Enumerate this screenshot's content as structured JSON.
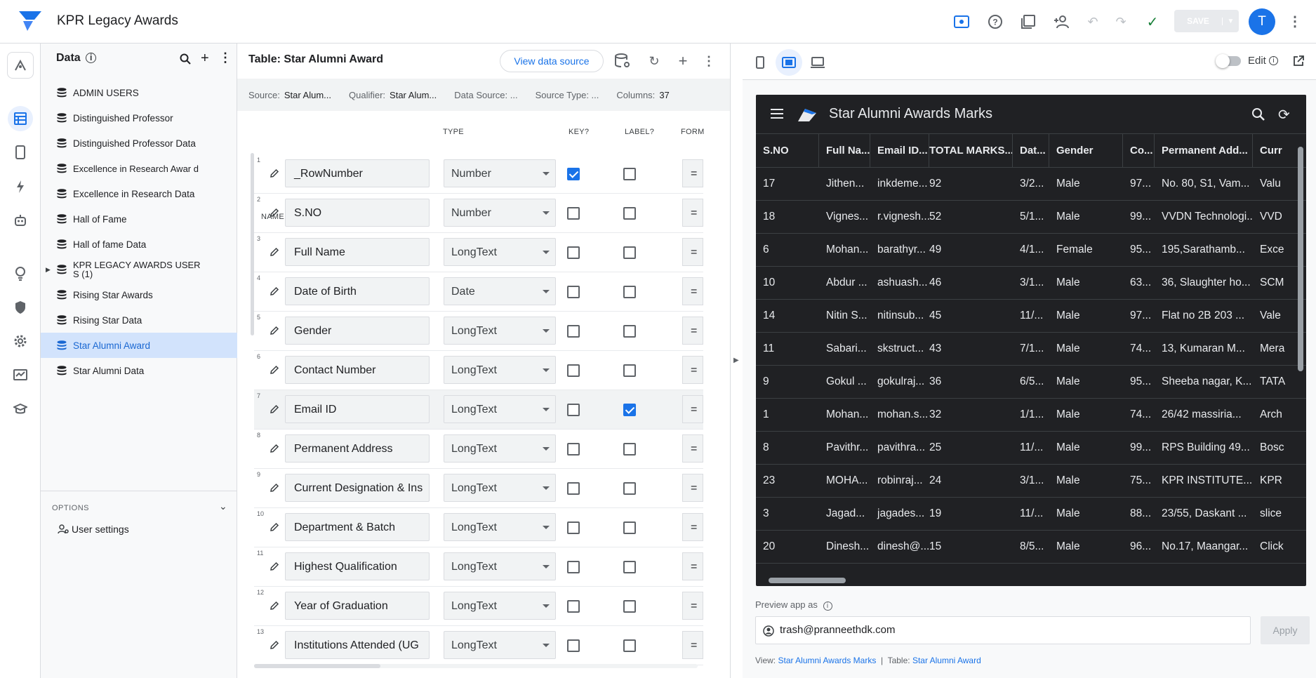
{
  "app": {
    "title": "KPR Legacy Awards",
    "accent": "#1a73e8"
  },
  "toolbar": {
    "save_label": "SAVE",
    "avatar_letter": "T"
  },
  "data_panel": {
    "title": "Data",
    "items": [
      {
        "label": "ADMIN USERS"
      },
      {
        "label": "Distinguished Professor"
      },
      {
        "label": "Distinguished Professor Data"
      },
      {
        "label": "Excellence in Research Awar d"
      },
      {
        "label": "Excellence in Research Data"
      },
      {
        "label": "Hall of Fame"
      },
      {
        "label": "Hall of fame Data"
      },
      {
        "label": "KPR LEGACY AWARDS USER S (1)"
      },
      {
        "label": "Rising Star Awards"
      },
      {
        "label": "Rising Star Data"
      },
      {
        "label": "Star Alumni Award"
      },
      {
        "label": "Star Alumni Data"
      }
    ],
    "options_label": "OPTIONS",
    "user_settings": "User settings"
  },
  "table_panel": {
    "title": "Table: Star Alumni Award",
    "view_source_btn": "View data source",
    "meta": {
      "source_label": "Source:",
      "source_value": "Star Alum...",
      "qualifier_label": "Qualifier:",
      "qualifier_value": "Star Alum...",
      "datasource_label": "Data Source: ...",
      "sourcetype_label": "Source Type: ...",
      "columns_label": "Columns:",
      "columns_value": "37"
    },
    "headers": {
      "name": "NAME",
      "type": "TYPE",
      "key": "KEY?",
      "label": "LABEL?",
      "formula": "FORM"
    },
    "columns": [
      {
        "num": "1",
        "name": "_RowNumber",
        "type": "Number",
        "key": true,
        "label": false,
        "eq": "="
      },
      {
        "num": "2",
        "name": "S.NO",
        "type": "Number",
        "key": false,
        "label": false,
        "eq": "="
      },
      {
        "num": "3",
        "name": "Full Name",
        "type": "LongText",
        "key": false,
        "label": false,
        "eq": "="
      },
      {
        "num": "4",
        "name": "Date of Birth",
        "type": "Date",
        "key": false,
        "label": false,
        "eq": "="
      },
      {
        "num": "5",
        "name": "Gender",
        "type": "LongText",
        "key": false,
        "label": false,
        "eq": "="
      },
      {
        "num": "6",
        "name": "Contact Number",
        "type": "LongText",
        "key": false,
        "label": false,
        "eq": "="
      },
      {
        "num": "7",
        "name": "Email ID",
        "type": "LongText",
        "key": false,
        "label": true,
        "eq": "="
      },
      {
        "num": "8",
        "name": "Permanent Address",
        "type": "LongText",
        "key": false,
        "label": false,
        "eq": "="
      },
      {
        "num": "9",
        "name": "Current Designation & Ins",
        "type": "LongText",
        "key": false,
        "label": false,
        "eq": "="
      },
      {
        "num": "10",
        "name": "Department & Batch",
        "type": "LongText",
        "key": false,
        "label": false,
        "eq": "="
      },
      {
        "num": "11",
        "name": "Highest Qualification",
        "type": "LongText",
        "key": false,
        "label": false,
        "eq": "="
      },
      {
        "num": "12",
        "name": "Year of Graduation",
        "type": "LongText",
        "key": false,
        "label": false,
        "eq": "="
      },
      {
        "num": "13",
        "name": "Institutions Attended (UG",
        "type": "LongText",
        "key": false,
        "label": false,
        "eq": "="
      }
    ]
  },
  "preview": {
    "edit_label": "Edit",
    "app_title": "Star Alumni Awards Marks",
    "grid_headers": [
      "S.NO",
      "Full Na...",
      "Email ID...",
      "TOTAL MARKS...",
      "Dat...",
      "Gender",
      "Co...",
      "Permanent Add...",
      "Curr"
    ],
    "grid_rows": [
      [
        "17",
        "Jithen...",
        "inkdeme...",
        "92",
        "3/2...",
        "Male",
        "97...",
        "No. 80, S1, Vam...",
        "Valu"
      ],
      [
        "18",
        "Vignes...",
        "r.vignesh...",
        "52",
        "5/1...",
        "Male",
        "99...",
        "VVDN Technologi...",
        "VVD"
      ],
      [
        "6",
        "Mohan...",
        "barathyr...",
        "49",
        "4/1...",
        "Female",
        "95...",
        "195,Sarathamb...",
        "Exce"
      ],
      [
        "10",
        "Abdur ...",
        "ashuash...",
        "46",
        "3/1...",
        "Male",
        "63...",
        "36, Slaughter ho...",
        "SCM"
      ],
      [
        "14",
        "Nitin S...",
        "nitinsub...",
        "45",
        "11/...",
        "Male",
        "97...",
        "Flat no 2B 203 ...",
        "Vale"
      ],
      [
        "11",
        "Sabari...",
        "skstruct...",
        "43",
        "7/1...",
        "Male",
        "74...",
        "13, Kumaran M...",
        "Mera"
      ],
      [
        "9",
        "Gokul ...",
        "gokulraj...",
        "36",
        "6/5...",
        "Male",
        "95...",
        "Sheeba nagar, K...",
        "TATA"
      ],
      [
        "1",
        "Mohan...",
        "mohan.s...",
        "32",
        "1/1...",
        "Male",
        "74...",
        "26/42 massiria...",
        "Arch"
      ],
      [
        "8",
        "Pavithr...",
        "pavithra...",
        "25",
        "11/...",
        "Male",
        "99...",
        "RPS Building 49...",
        "Bosc"
      ],
      [
        "23",
        "MOHA...",
        "robinraj...",
        "24",
        "3/1...",
        "Male",
        "75...",
        "KPR INSTITUTE...",
        "KPR"
      ],
      [
        "3",
        "Jagad...",
        "jagades...",
        "19",
        "11/...",
        "Male",
        "88...",
        "23/55, Daskant ...",
        "slice"
      ],
      [
        "20",
        "Dinesh...",
        "dinesh@...",
        "15",
        "8/5...",
        "Male",
        "96...",
        "No.17, Maangar...",
        "Click"
      ]
    ],
    "preview_as_label": "Preview app as",
    "preview_email": "trash@pranneethdk.com",
    "apply_btn": "Apply",
    "footer": {
      "view_label": "View:",
      "view_value": "Star Alumni Awards Marks",
      "sep": "|",
      "table_label": "Table:",
      "table_value": "Star Alumni Award"
    }
  }
}
